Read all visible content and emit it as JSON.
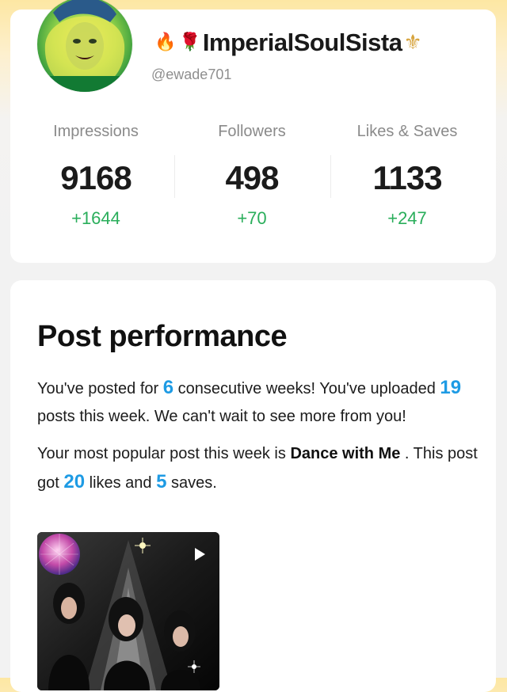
{
  "profile": {
    "display_name": "ImperialSoulSista",
    "name_prefix_emojis": [
      "fire-emoji",
      "rose-emoji"
    ],
    "name_suffix_emoji": "fleur-de-lis-emoji",
    "handle": "@ewade701"
  },
  "stats": [
    {
      "label": "Impressions",
      "value": "9168",
      "delta": "+1644"
    },
    {
      "label": "Followers",
      "value": "498",
      "delta": "+70"
    },
    {
      "label": "Likes & Saves",
      "value": "1133",
      "delta": "+247"
    }
  ],
  "performance": {
    "title": "Post performance",
    "p1_a": "You've posted for ",
    "weeks": "6",
    "p1_b": " consecutive weeks! You've uploaded ",
    "posts": "19",
    "p1_c": " posts this week. We can't wait to see more from you!",
    "p2_a": "Your most popular post this week is ",
    "post_name": "Dance with Me",
    "p2_b": " . This post got ",
    "likes": "20",
    "p2_c": " likes and ",
    "saves": "5",
    "p2_d": " saves."
  },
  "colors": {
    "accent_blue": "#1e9be4",
    "delta_green": "#2aae5b",
    "header_yellow": "#fde7a3"
  },
  "icons": {
    "video": "play-icon"
  }
}
